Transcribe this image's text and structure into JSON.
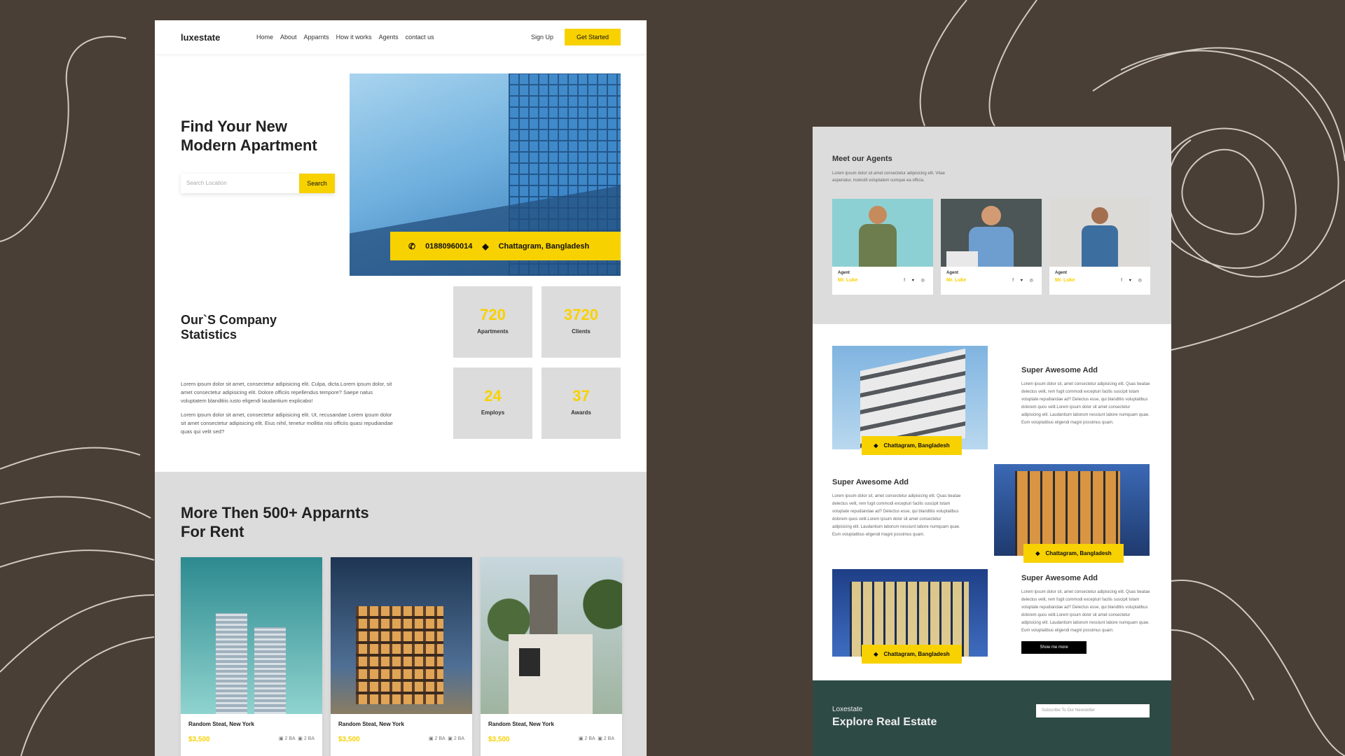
{
  "left_page": {
    "nav": {
      "logo": "luxestate",
      "links": [
        "Home",
        "About",
        "Apparnts",
        "How it works",
        "Agents",
        "contact us"
      ],
      "signup": "Sign Up",
      "cta": "Get Started"
    },
    "hero": {
      "title": "Find Your New Modern Apartment",
      "search_placeholder": "Search Location",
      "search_button": "Search",
      "phone_icon": "phone-icon",
      "phone": "01880960014",
      "location_icon": "location-icon",
      "location": "Chattagram, Bangladesh"
    },
    "stats": {
      "title": "Our`S Company Statistics",
      "para1": "Lorem ipsum dolor sit amet, consectetur adipisicing elit. Culpa, dicta.Lorem ipsum dolor, sit amet consectetur adipisicing elit. Dolore officiis repellendus tempore? Saepe natus voluptatem blanditiis iusto eligendi laudantium explicabo!",
      "para2": "Lorem ipsum dolor sit amet, consectetur adipisicing elit. Ut, recusandae Lorem ipsum dolor sit amet consectetur adipisicing elit. Eius nihil, tenetur mollitia nisi officiis quasi repudiandae quas qui velit sed?",
      "items": [
        {
          "value": "720",
          "label": "Apartments"
        },
        {
          "value": "3720",
          "label": "Clients"
        },
        {
          "value": "24",
          "label": "Employs"
        },
        {
          "value": "37",
          "label": "Awards"
        }
      ]
    },
    "rent": {
      "title": "More Then 500+ Apparnts For Rent",
      "cards": [
        {
          "title": "Random Steat, New York",
          "price": "$3,500",
          "beds": "2 BA",
          "baths": "2 BA"
        },
        {
          "title": "Random Steat, New York",
          "price": "$3,500",
          "beds": "2 BA",
          "baths": "2 BA"
        },
        {
          "title": "Random Steat, New York",
          "price": "$3,500",
          "beds": "2 BA",
          "baths": "2 BA"
        }
      ]
    }
  },
  "right_page": {
    "agents": {
      "title": "Meet our Agents",
      "subtitle": "Lorem ipsum dolor sit amet consectetur adipisicing elit. Vitae asperiatur, molestit voluptatem cumque ea officia.",
      "items": [
        {
          "role": "Agent",
          "name": "Mr. Luke",
          "social": "f ♥ ◎"
        },
        {
          "role": "Agent",
          "name": "Mr. Luke",
          "social": "f ♥ ◎"
        },
        {
          "role": "Agent",
          "name": "Mr. Luke",
          "social": "f ♥ ◎"
        }
      ]
    },
    "ads": [
      {
        "title": "Super Awesome Add",
        "location": "Chattagram, Bangladesh",
        "text": "Lorem ipsum dolor sit, amet consectetur adipisicing elit. Quas beatae delectus velit, rem fugit commodi excepturi facilis suscipit totam voluptate repudiandae ad? Delectus esse, qui blanditiis voluptatibus dolorem quos velit.Lorem ipsum dolor sit amet consectetur adipisicing elit. Laudantium laborum nesciunt labore numquam quae. Eum voluptatibus eligendi magni possimus quam."
      },
      {
        "title": "Super Awesome Add",
        "location": "Chattagram, Bangladesh",
        "text": "Lorem ipsum dolor sit, amet consectetur adipisicing elit. Quas beatae delectus velit, rem fugit commodi excepturi facilis suscipit totam voluptate repudiandae ad? Delectus esse, qui blanditiis voluptatibus dolorem quos velit.Lorem ipsum dolor sit amet consectetur adipisicing elit. Laudantium laborum nesciunt labore numquam quae. Eum voluptatibus eligendi magni possimus quam."
      },
      {
        "title": "Super Awesome Add",
        "location": "Chattagram, Bangladesh",
        "text": "Lorem ipsum dolor sit, amet consectetur adipisicing elit. Quas beatae delectus velit, rem fugit commodi excepturi facilis suscipit totam voluptate repudiandae ad? Delectus esse, qui blanditiis voluptatibus dolorem quos velit.Lorem ipsum dolor sit amet consectetur adipisicing elit. Laudantium laborum nesciunt labore numquam quae. Eum voluptatibus eligendi magni possimus quam."
      }
    ],
    "show_more": "Show me more",
    "footer": {
      "brand": "Loxestate",
      "tagline": "Explore Real Estate",
      "newsletter_placeholder": "Subscribe To Our Newsletter"
    }
  },
  "colors": {
    "background": "#4a3f36",
    "accent": "#f8d100",
    "footer": "#2e4a45",
    "section_gray": "#dcdcdc"
  }
}
